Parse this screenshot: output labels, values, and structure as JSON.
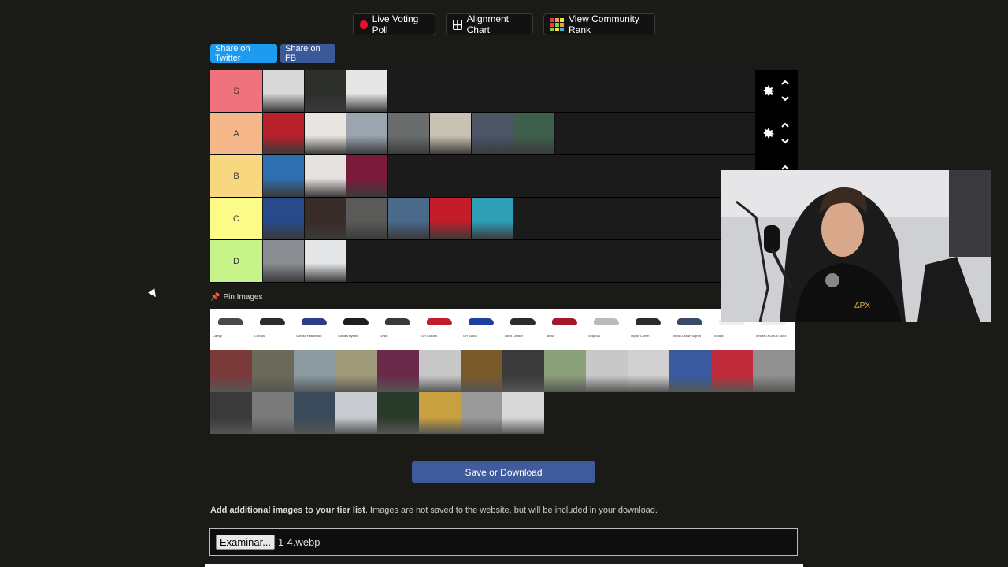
{
  "top_buttons": {
    "live_poll": "Live Voting Poll",
    "alignment": "Alignment Chart",
    "community": "View Community Rank"
  },
  "share": {
    "twitter": "Share on Twitter",
    "fb": "Share on FB"
  },
  "tiers": [
    {
      "label": "S",
      "color": "#f0727c",
      "items": [
        "#d9d9d9",
        "#2c2f2a",
        "#e6e6e6"
      ]
    },
    {
      "label": "A",
      "color": "#f5b78a",
      "items": [
        "#b8202a",
        "#e8e4df",
        "#9aa5b0",
        "#6a6d6e",
        "#c9c2b4",
        "#4c5667",
        "#3e5f4c"
      ]
    },
    {
      "label": "B",
      "color": "#f7d880",
      "items": [
        "#2e6fb0",
        "#e6e2e0",
        "#7a1a3a"
      ]
    },
    {
      "label": "C",
      "color": "#fcfb87",
      "items": [
        "#284a8c",
        "#3a2c28",
        "#5a5a58",
        "#4a6a8c",
        "#c41d2a",
        "#2da0b8"
      ]
    },
    {
      "label": "D",
      "color": "#c7f48a",
      "items": [
        "#8b8f93",
        "#e4e6e8"
      ]
    }
  ],
  "pin_label": "Pin Images",
  "pool_cards": [
    {
      "car_color": "#4a4a4a",
      "name": "Camry"
    },
    {
      "car_color": "#2b2b2b",
      "name": "Corolla"
    },
    {
      "car_color": "#2b3e8a",
      "name": "Corolla Hatchback"
    },
    {
      "car_color": "#1e1e1e",
      "name": "Corolla Hybrid"
    },
    {
      "car_color": "#3a3a3a",
      "name": "GR86"
    },
    {
      "car_color": "#c41d2a",
      "name": "GR Corolla"
    },
    {
      "car_color": "#1f3ea0",
      "name": "GR Supra"
    },
    {
      "car_color": "#2b2b2b",
      "name": "Land Cruiser"
    },
    {
      "car_color": "#a21a2a",
      "name": "Mirai"
    },
    {
      "car_color": "#bbbbbb",
      "name": "Sequoia"
    },
    {
      "car_color": "#2b2b2b",
      "name": "Toyota Crown"
    },
    {
      "car_color": "#3a4a6a",
      "name": "Toyota Crown Signia"
    },
    {
      "car_color": "#eeeeee",
      "name": "Tundra"
    },
    {
      "car_color": "#eeeeee",
      "name": "Tundra i-FORCE MAX"
    }
  ],
  "pool_photos": [
    "#7a3a3a",
    "#6a6a5a",
    "#8a9aa0",
    "#a09a7a",
    "#6a2a4a",
    "#c8c8c8",
    "#7a5a2a",
    "#3a3a3a",
    "#8aa07a",
    "#c8c8c8",
    "#d0d0d0",
    "#3a5aa0",
    "#c02a3a",
    "#909090",
    "#3a3a3a",
    "#7a7a7a",
    "#3a4a5a",
    "#c8ccd0",
    "#2a3a2a",
    "#c8a040",
    "#9a9a9a",
    "#d8d8d8"
  ],
  "save_label": "Save or Download",
  "note": {
    "bold": "Add additional images to your tier list",
    "rest": ". Images are not saved to the website, but will be included in your download."
  },
  "file": {
    "button": "Examinar...",
    "name": "1-4.webp"
  }
}
